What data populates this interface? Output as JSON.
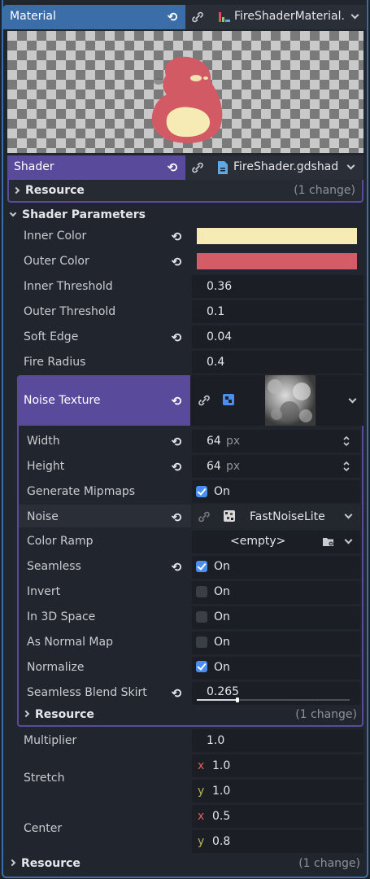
{
  "material": {
    "label": "Material",
    "resource_name": "FireShaderMaterial.",
    "shader_label": "Shader",
    "shader_resource": "FireShader.gdshad",
    "resource_label": "Resource",
    "resource_changes": "(1 change)"
  },
  "shader_params": {
    "title": "Shader Parameters",
    "inner_color": {
      "label": "Inner Color",
      "color": "#f6ebb4"
    },
    "outer_color": {
      "label": "Outer Color",
      "color": "#d45c66"
    },
    "inner_threshold": {
      "label": "Inner Threshold",
      "value": "0.36"
    },
    "outer_threshold": {
      "label": "Outer Threshold",
      "value": "0.1"
    },
    "soft_edge": {
      "label": "Soft Edge",
      "value": "0.04"
    },
    "fire_radius": {
      "label": "Fire Radius",
      "value": "0.4"
    },
    "noise_texture": {
      "label": "Noise Texture"
    }
  },
  "noise_texture": {
    "width": {
      "label": "Width",
      "value": "64",
      "unit": "px"
    },
    "height": {
      "label": "Height",
      "value": "64",
      "unit": "px"
    },
    "generate_mipmaps": {
      "label": "Generate Mipmaps",
      "checked": true,
      "text": "On"
    },
    "noise": {
      "label": "Noise",
      "resource": "FastNoiseLite"
    },
    "color_ramp": {
      "label": "Color Ramp",
      "value": "<empty>"
    },
    "seamless": {
      "label": "Seamless",
      "checked": true,
      "text": "On"
    },
    "invert": {
      "label": "Invert",
      "checked": false,
      "text": "On"
    },
    "in_3d_space": {
      "label": "In 3D Space",
      "checked": false,
      "text": "On"
    },
    "as_normal_map": {
      "label": "As Normal Map",
      "checked": false,
      "text": "On"
    },
    "normalize": {
      "label": "Normalize",
      "checked": true,
      "text": "On"
    },
    "seamless_blend_skirt": {
      "label": "Seamless Blend Skirt",
      "value": "0.265",
      "fraction": 0.265
    },
    "resource_label": "Resource",
    "resource_changes": "(1 change)"
  },
  "more_params": {
    "multiplier": {
      "label": "Multiplier",
      "value": "1.0"
    },
    "stretch": {
      "label": "Stretch",
      "x_label": "x",
      "x": "1.0",
      "y_label": "y",
      "y": "1.0"
    },
    "center": {
      "label": "Center",
      "x_label": "x",
      "x": "0.5",
      "y_label": "y",
      "y": "0.8"
    }
  },
  "footer": {
    "resource_label": "Resource",
    "resource_changes": "(1 change)"
  },
  "colors": {
    "material_header": "#3b6ea8",
    "shader_header": "#5a4a9c",
    "accent_check": "#4b8ef0"
  },
  "icons": [
    "revert-icon",
    "link-icon",
    "shader-file-icon",
    "material-icon",
    "texture-icon",
    "noise-icon",
    "folder-icon",
    "chevron-down-icon",
    "chevron-right-icon",
    "spinner-icon"
  ]
}
